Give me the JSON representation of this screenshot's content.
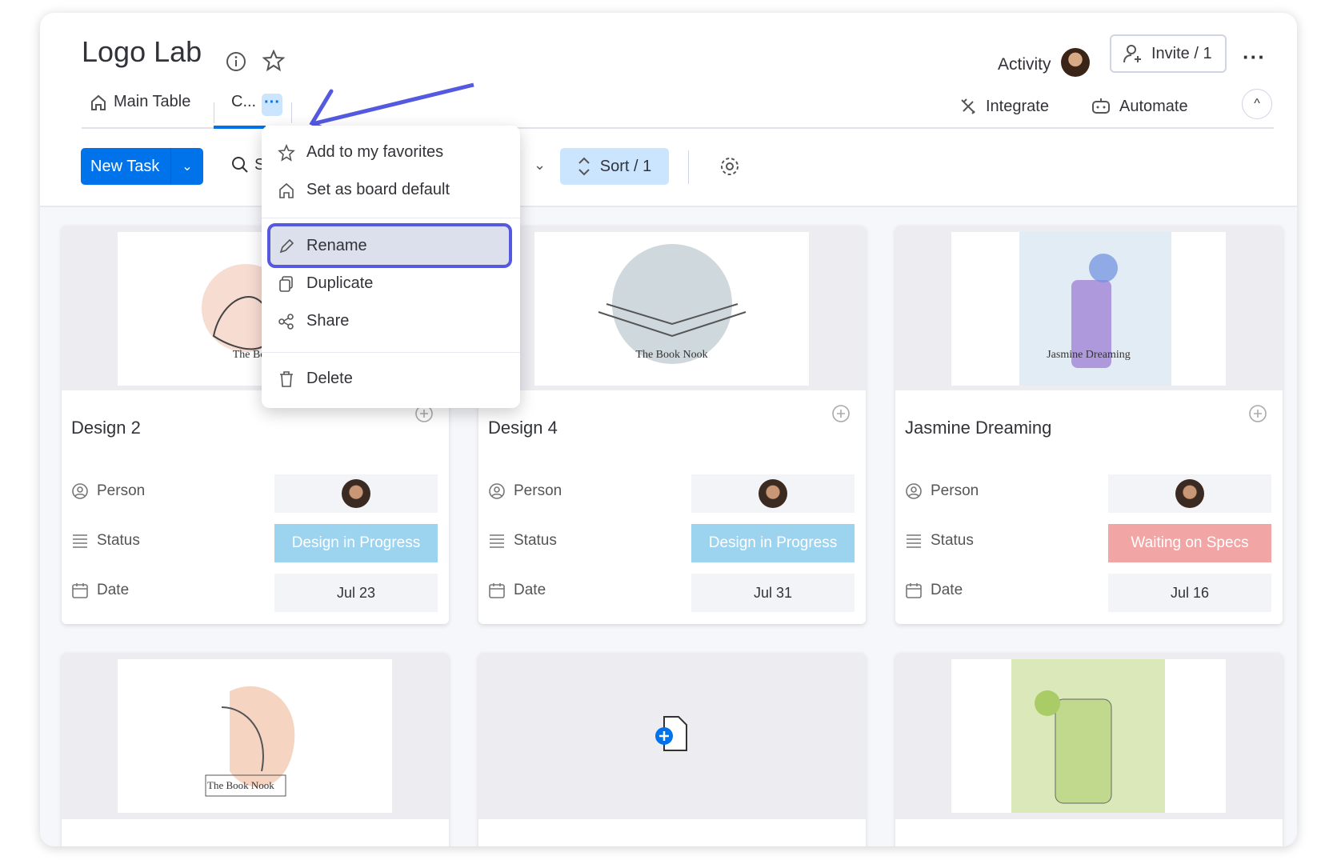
{
  "header": {
    "title": "Logo Lab",
    "activity_label": "Activity",
    "invite_label": "Invite / 1"
  },
  "tabs": [
    {
      "label": "Main Table"
    },
    {
      "label": "C..."
    }
  ],
  "right_actions": {
    "integrate": "Integrate",
    "automate": "Automate"
  },
  "toolbar": {
    "new_task": "New Task",
    "search_partial": "S",
    "sort": "Sort / 1"
  },
  "context_menu": {
    "items": [
      {
        "label": "Add to my favorites",
        "icon": "star-icon"
      },
      {
        "label": "Set as board default",
        "icon": "home-icon"
      },
      {
        "label": "Rename",
        "icon": "pencil-icon",
        "highlighted": true
      },
      {
        "label": "Duplicate",
        "icon": "copy-icon"
      },
      {
        "label": "Share",
        "icon": "share-icon"
      },
      {
        "label": "Delete",
        "icon": "trash-icon"
      }
    ]
  },
  "field_labels": {
    "person": "Person",
    "status": "Status",
    "date": "Date"
  },
  "cards": [
    {
      "title": "Design 2",
      "status": "Design in Progress",
      "status_color": "#9cd3ef",
      "date": "Jul 23",
      "image_caption": "The Book"
    },
    {
      "title": "Design 4",
      "status": "Design in Progress",
      "status_color": "#9cd3ef",
      "date": "Jul 31",
      "image_caption": "The Book Nook"
    },
    {
      "title": "Jasmine Dreaming",
      "status": "Waiting on Specs",
      "status_color": "#f2a5a5",
      "date": "Jul 16",
      "image_caption": "Jasmine Dreaming"
    }
  ],
  "second_row": [
    {
      "image_caption": "The Book Nook"
    },
    {
      "image_caption": ""
    },
    {
      "image_caption": ""
    }
  ],
  "colors": {
    "primary": "#0073ea",
    "annotation": "#5559df",
    "sort_bg": "#cce5ff"
  }
}
